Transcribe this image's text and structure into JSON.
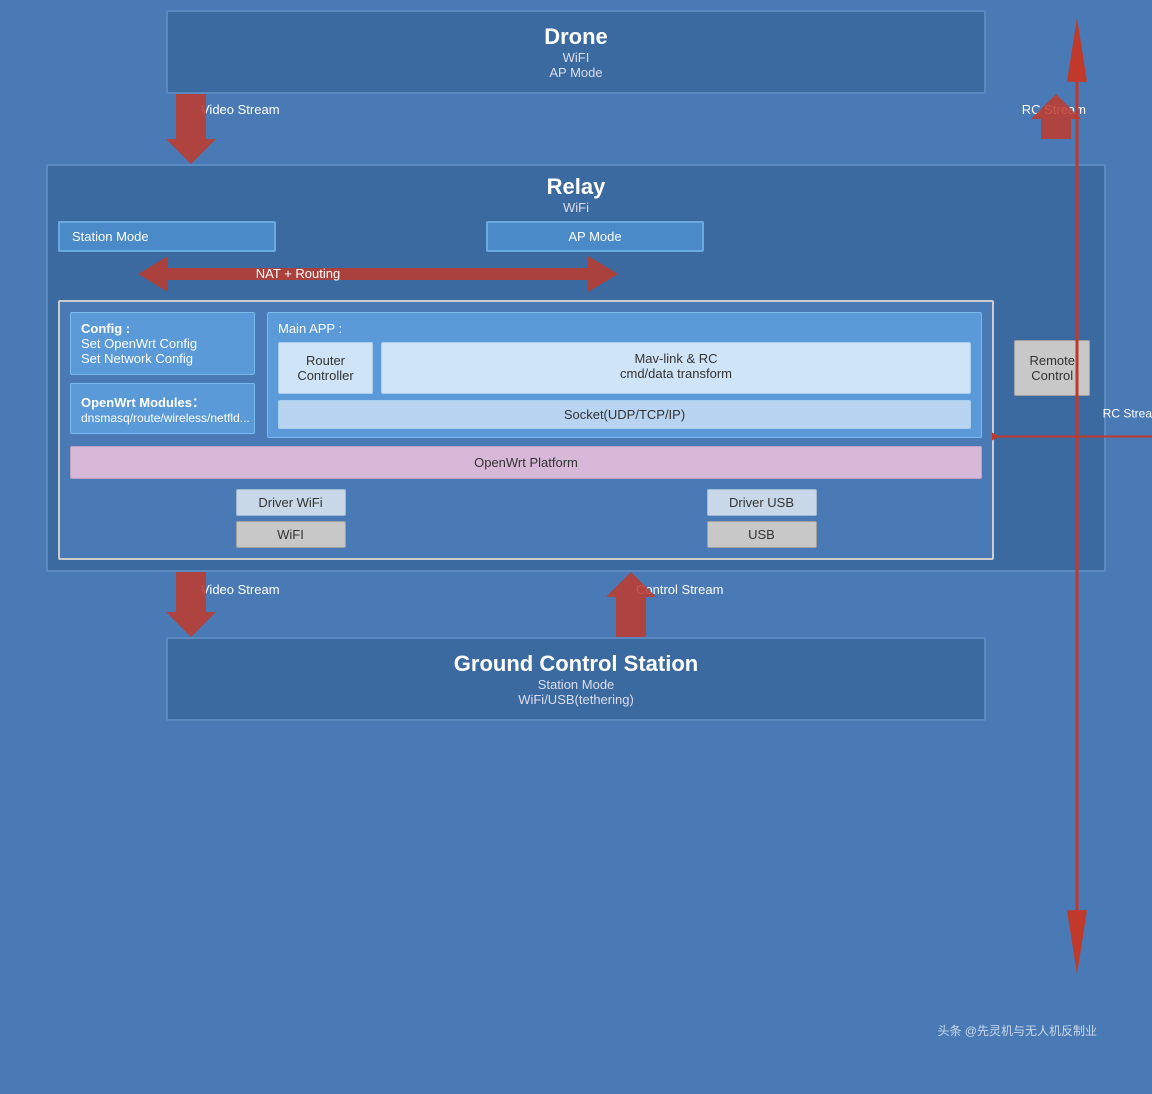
{
  "diagram": {
    "drone": {
      "title": "Drone",
      "subtitle1": "WiFI",
      "subtitle2": "AP Mode"
    },
    "relay": {
      "title": "Relay",
      "subtitle": "WiFi"
    },
    "station_mode": "Station Mode",
    "ap_mode": "AP Mode",
    "nat_routing": "NAT + Routing",
    "video_stream_top": "Video Stream",
    "rc_stream_top": "RC Stream",
    "rc_stream_mid": "RC Stream",
    "inner": {
      "config_label": "Config :",
      "config_line1": "Set OpenWrt Config",
      "config_line2": "Set Network Config",
      "main_app_label": "Main APP :",
      "router_controller": "Router\nController",
      "mavlink_label": "Mav-link & RC\ncmd/data transform",
      "socket_label": "Socket(UDP/TCP/IP)",
      "openwrt_modules_label": "OpenWrt Modules：",
      "openwrt_modules_detail": "dnsmasq/route/wireless/netfld...",
      "openwrt_platform": "OpenWrt Platform",
      "driver_wifi": "Driver WiFi",
      "wifi": "WiFI",
      "driver_usb": "Driver USB",
      "usb": "USB"
    },
    "remote_control": "Remote\nControl",
    "video_stream_bottom": "Video Stream",
    "control_stream": "Control Stream",
    "gcs": {
      "title": "Ground Control Station",
      "subtitle1": "Station Mode",
      "subtitle2": "WiFi/USB(tethering)"
    },
    "watermark": "头条 @先灵机与无人机反制业"
  }
}
